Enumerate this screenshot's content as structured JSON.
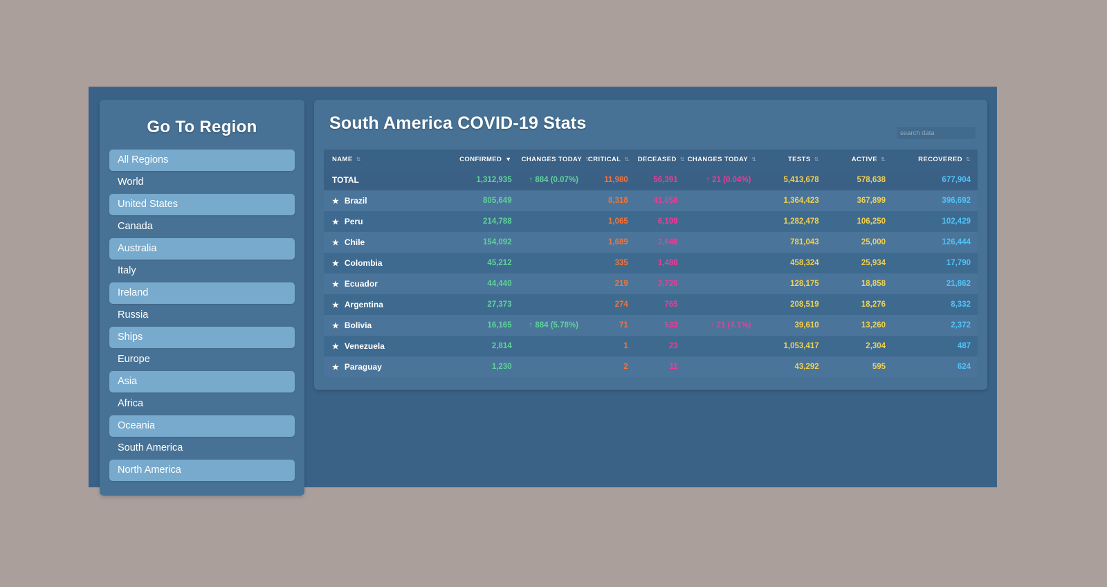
{
  "sidebar": {
    "title": "Go To Region",
    "items": [
      {
        "label": "All Regions"
      },
      {
        "label": "World"
      },
      {
        "label": "United States"
      },
      {
        "label": "Canada"
      },
      {
        "label": "Australia"
      },
      {
        "label": "Italy"
      },
      {
        "label": "Ireland"
      },
      {
        "label": "Russia"
      },
      {
        "label": "Ships"
      },
      {
        "label": "Europe"
      },
      {
        "label": "Asia"
      },
      {
        "label": "Africa"
      },
      {
        "label": "Oceania"
      },
      {
        "label": "South America"
      },
      {
        "label": "North America"
      }
    ]
  },
  "main": {
    "title": "South America COVID-19 Stats",
    "search": {
      "value": "",
      "placeholder": "search data"
    }
  },
  "colors": {
    "page_background": "#ab9f9c",
    "window_background": "#3a6287",
    "panel_background": "#477295",
    "sidebar_item_active": "#77aacd",
    "confirmed": "#5fd39a",
    "critical": "#f0743c",
    "deceased": "#ec3d96",
    "tests": "#f0d152",
    "active": "#f0d152",
    "recovered": "#4fc3f7"
  },
  "table": {
    "sorted_column": "CONFIRMED",
    "sort_direction": "desc",
    "sort_glyph_active": "▼",
    "sort_glyph_idle": "⇅",
    "star_glyph": "★",
    "columns": [
      {
        "key": "name",
        "label": "NAME",
        "sorted": false
      },
      {
        "key": "confirmed",
        "label": "CONFIRMED",
        "sorted": true
      },
      {
        "key": "changes1",
        "label": "CHANGES TODAY",
        "sorted": false
      },
      {
        "key": "critical",
        "label": "CRITICAL",
        "sorted": false
      },
      {
        "key": "deceased",
        "label": "DECEASED",
        "sorted": false
      },
      {
        "key": "changes2",
        "label": "CHANGES TODAY",
        "sorted": false
      },
      {
        "key": "tests",
        "label": "TESTS",
        "sorted": false
      },
      {
        "key": "active",
        "label": "ACTIVE",
        "sorted": false
      },
      {
        "key": "recovered",
        "label": "RECOVERED",
        "sorted": false
      }
    ],
    "total_row": {
      "name": "TOTAL",
      "starred": false,
      "confirmed": "1,312,935",
      "changes1": "↑ 884 (0.07%)",
      "critical": "11,980",
      "deceased": "56,391",
      "changes2": "↑ 21 (0.04%)",
      "tests": "5,413,678",
      "active": "578,638",
      "recovered": "677,904"
    },
    "rows": [
      {
        "name": "Brazil",
        "starred": true,
        "confirmed": "805,649",
        "changes1": "",
        "critical": "8,318",
        "deceased": "41,058",
        "changes2": "",
        "tests": "1,364,423",
        "active": "367,899",
        "recovered": "396,692"
      },
      {
        "name": "Peru",
        "starred": true,
        "confirmed": "214,788",
        "changes1": "",
        "critical": "1,065",
        "deceased": "6,109",
        "changes2": "",
        "tests": "1,282,478",
        "active": "106,250",
        "recovered": "102,429"
      },
      {
        "name": "Chile",
        "starred": true,
        "confirmed": "154,092",
        "changes1": "",
        "critical": "1,689",
        "deceased": "2,648",
        "changes2": "",
        "tests": "781,043",
        "active": "25,000",
        "recovered": "126,444"
      },
      {
        "name": "Colombia",
        "starred": true,
        "confirmed": "45,212",
        "changes1": "",
        "critical": "335",
        "deceased": "1,488",
        "changes2": "",
        "tests": "458,324",
        "active": "25,934",
        "recovered": "17,790"
      },
      {
        "name": "Ecuador",
        "starred": true,
        "confirmed": "44,440",
        "changes1": "",
        "critical": "219",
        "deceased": "3,720",
        "changes2": "",
        "tests": "128,175",
        "active": "18,858",
        "recovered": "21,862"
      },
      {
        "name": "Argentina",
        "starred": true,
        "confirmed": "27,373",
        "changes1": "",
        "critical": "274",
        "deceased": "765",
        "changes2": "",
        "tests": "208,519",
        "active": "18,276",
        "recovered": "8,332"
      },
      {
        "name": "Bolivia",
        "starred": true,
        "confirmed": "16,165",
        "changes1": "↑ 884 (5.78%)",
        "critical": "71",
        "deceased": "533",
        "changes2": "↑ 21 (4.1%)",
        "tests": "39,610",
        "active": "13,260",
        "recovered": "2,372"
      },
      {
        "name": "Venezuela",
        "starred": true,
        "confirmed": "2,814",
        "changes1": "",
        "critical": "1",
        "deceased": "23",
        "changes2": "",
        "tests": "1,053,417",
        "active": "2,304",
        "recovered": "487"
      },
      {
        "name": "Paraguay",
        "starred": true,
        "confirmed": "1,230",
        "changes1": "",
        "critical": "2",
        "deceased": "11",
        "changes2": "",
        "tests": "43,292",
        "active": "595",
        "recovered": "624"
      }
    ]
  }
}
